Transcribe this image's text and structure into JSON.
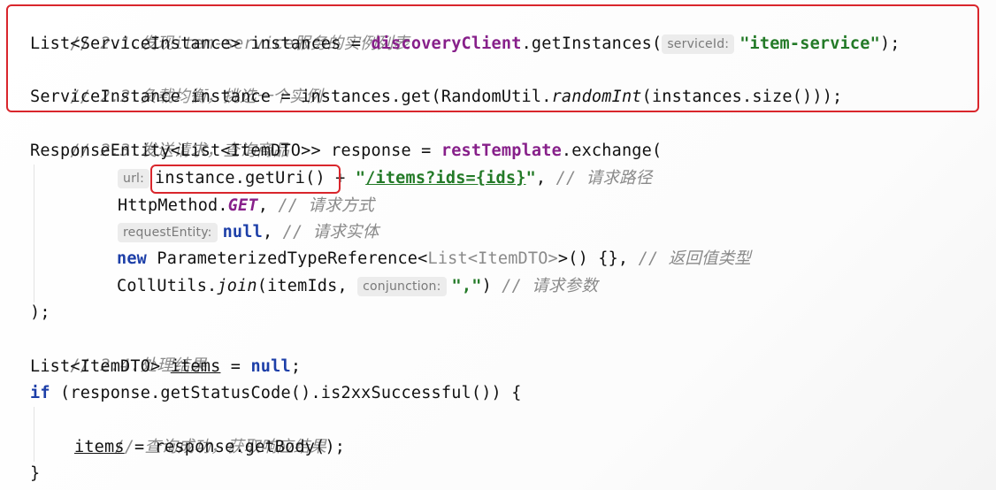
{
  "code": {
    "l1_comment": "// 2.1.发现item-service服务的实例列表",
    "l2_a": "List<ServiceInstance> instances = ",
    "l2_b": "discoveryClient",
    "l2_c": ".getInstances(",
    "l2_hint": "serviceId:",
    "l2_str": "\"item-service\"",
    "l2_d": ");",
    "l3_comment": "// 2.2.负载均衡，挑选一个实例",
    "l4_a": "ServiceInstance instance = instances.get(RandomUtil.",
    "l4_it": "randomInt",
    "l4_b": "(instances.size()));",
    "l5_comment": "// 2.3.发送请求，查询商品",
    "l6_a": "ResponseEntity<List<ItemDTO>> response = ",
    "l6_b": "restTemplate",
    "l6_c": ".exchange(",
    "l7_hint": "url:",
    "l7_a": "instance.getUri()",
    "l7_b": " + ",
    "l7_q1": "\"",
    "l7_link": "/items?ids={ids}",
    "l7_q2": "\"",
    "l7_c": ", ",
    "l7_comment": "// 请求路径",
    "l8_a": "HttpMethod.",
    "l8_b": "GET",
    "l8_c": ", ",
    "l8_comment": "// 请求方式",
    "l9_hint": "requestEntity:",
    "l9_a": "null",
    "l9_b": ", ",
    "l9_comment": "// 请求实体",
    "l10_a": "new",
    "l10_b": " ParameterizedTypeReference<",
    "l10_gray": "List<ItemDTO>",
    "l10_c": ">() {}, ",
    "l10_comment": "// 返回值类型",
    "l11_a": "CollUtils.",
    "l11_it": "join",
    "l11_b": "(itemIds, ",
    "l11_hint": "conjunction:",
    "l11_str": "\",\"",
    "l11_c": ") ",
    "l11_comment": "// 请求参数",
    "l12": ");",
    "l13_comment": "// 2.4.处理结果",
    "l14_a": "List<ItemDTO> ",
    "l14_ul": "items",
    "l14_b": " = ",
    "l14_null": "null",
    "l14_c": ";",
    "l15_kw": "if",
    "l15_a": " (response.getStatusCode().is2xxSuccessful()) {",
    "l16_comment": "// 查询成功，获取响应结果",
    "l17_ul": "items",
    "l17_a": " = response.getBody();",
    "l18": "}"
  },
  "colors": {
    "highlight_box": "#d9262c",
    "keyword": "#1d3fa8",
    "field": "#87208a",
    "string": "#237a27",
    "comment": "#8a8a8a"
  }
}
